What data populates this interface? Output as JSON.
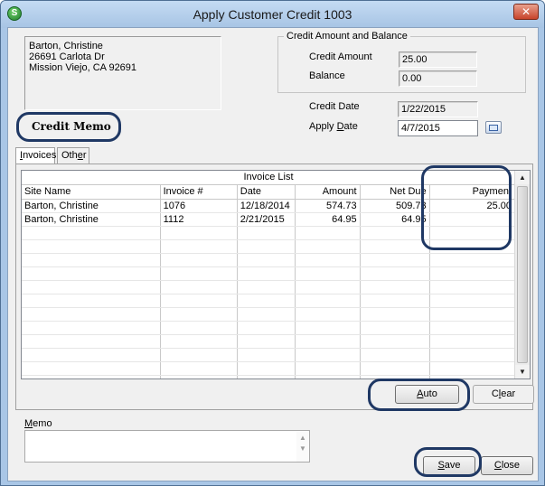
{
  "window": {
    "title": "Apply Customer Credit 1003",
    "app_icon_letter": "S",
    "close_label": "✕"
  },
  "customer": {
    "address_lines": [
      "Barton, Christine",
      "26691 Carlota Dr",
      "Mission Viejo, CA  92691"
    ]
  },
  "credit_memo_label": "Credit Memo",
  "credit_group": {
    "legend": "Credit Amount and Balance",
    "credit_amount_label": "Credit Amount",
    "credit_amount_value": "25.00",
    "balance_label": "Balance",
    "balance_value": "0.00"
  },
  "dates": {
    "credit_date_label": "Credit Date",
    "credit_date_value": "1/22/2015",
    "apply_date_label_pre": "Apply ",
    "apply_date_label_u": "D",
    "apply_date_label_post": "ate",
    "apply_date_value": "4/7/2015"
  },
  "tabs": [
    {
      "pre": "",
      "u": "I",
      "post": "nvoices"
    },
    {
      "pre": "Oth",
      "u": "e",
      "post": "r"
    }
  ],
  "invoice_list": {
    "caption": "Invoice List",
    "columns": [
      "Site Name",
      "Invoice #",
      "Date",
      "Amount",
      "Net Due",
      "Payment"
    ],
    "rows": [
      {
        "site": "Barton, Christine",
        "invoice": "1076",
        "date": "12/18/2014",
        "amount": "574.73",
        "net_due": "509.73",
        "payment": "25.00"
      },
      {
        "site": "Barton, Christine",
        "invoice": "1112",
        "date": "2/21/2015",
        "amount": "64.95",
        "net_due": "64.95",
        "payment": ""
      }
    ]
  },
  "buttons": {
    "auto": {
      "pre": "",
      "u": "A",
      "post": "uto"
    },
    "clear": {
      "pre": "C",
      "u": "l",
      "post": "ear"
    },
    "save": {
      "pre": "",
      "u": "S",
      "post": "ave"
    },
    "close": {
      "pre": "",
      "u": "C",
      "post": "lose"
    }
  },
  "memo": {
    "label_pre": "",
    "label_u": "M",
    "label_post": "emo",
    "value": ""
  },
  "colors": {
    "callout": "#1f3864",
    "title_bar": "#a9c6e6",
    "close_button": "#c8442b"
  }
}
